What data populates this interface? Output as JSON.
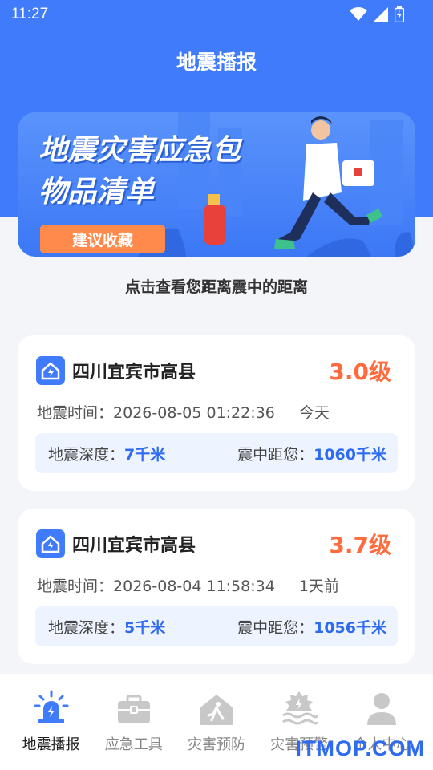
{
  "status_bar": {
    "time": "11:27"
  },
  "app_title": "地震播报",
  "banner": {
    "headline_line1": "地震灾害应急包",
    "headline_line2": "物品清单",
    "tag": "建议收藏"
  },
  "subtitle": "点击查看您距离震中的距离",
  "cards": [
    {
      "location": "四川宜宾市高县",
      "magnitude": "3.0级",
      "time_label": "地震时间：",
      "time_value": "2026-08-05 01:22:36",
      "relative": "今天",
      "depth_label": "地震深度：",
      "depth_value": "7千米",
      "distance_label": "震中距您：",
      "distance_value": "1060千米"
    },
    {
      "location": "四川宜宾市高县",
      "magnitude": "3.7级",
      "time_label": "地震时间：",
      "time_value": "2026-08-04 11:58:34",
      "relative": "1天前",
      "depth_label": "地震深度：",
      "depth_value": "5千米",
      "distance_label": "震中距您：",
      "distance_value": "1056千米"
    }
  ],
  "nav": [
    {
      "label": "地震播报",
      "icon": "alarm-siren-icon",
      "active": true
    },
    {
      "label": "应急工具",
      "icon": "toolbox-icon",
      "active": false
    },
    {
      "label": "灾害预防",
      "icon": "house-running-person-icon",
      "active": false
    },
    {
      "label": "灾害预警",
      "icon": "flood-warning-icon",
      "active": false
    },
    {
      "label": "个人中心",
      "icon": "user-icon",
      "active": false
    }
  ],
  "watermark": "ITMOP.COM",
  "colors": {
    "primary": "#3f7bfa",
    "magnitude": "#ff6b3d",
    "tag": "#ff8a4c"
  }
}
